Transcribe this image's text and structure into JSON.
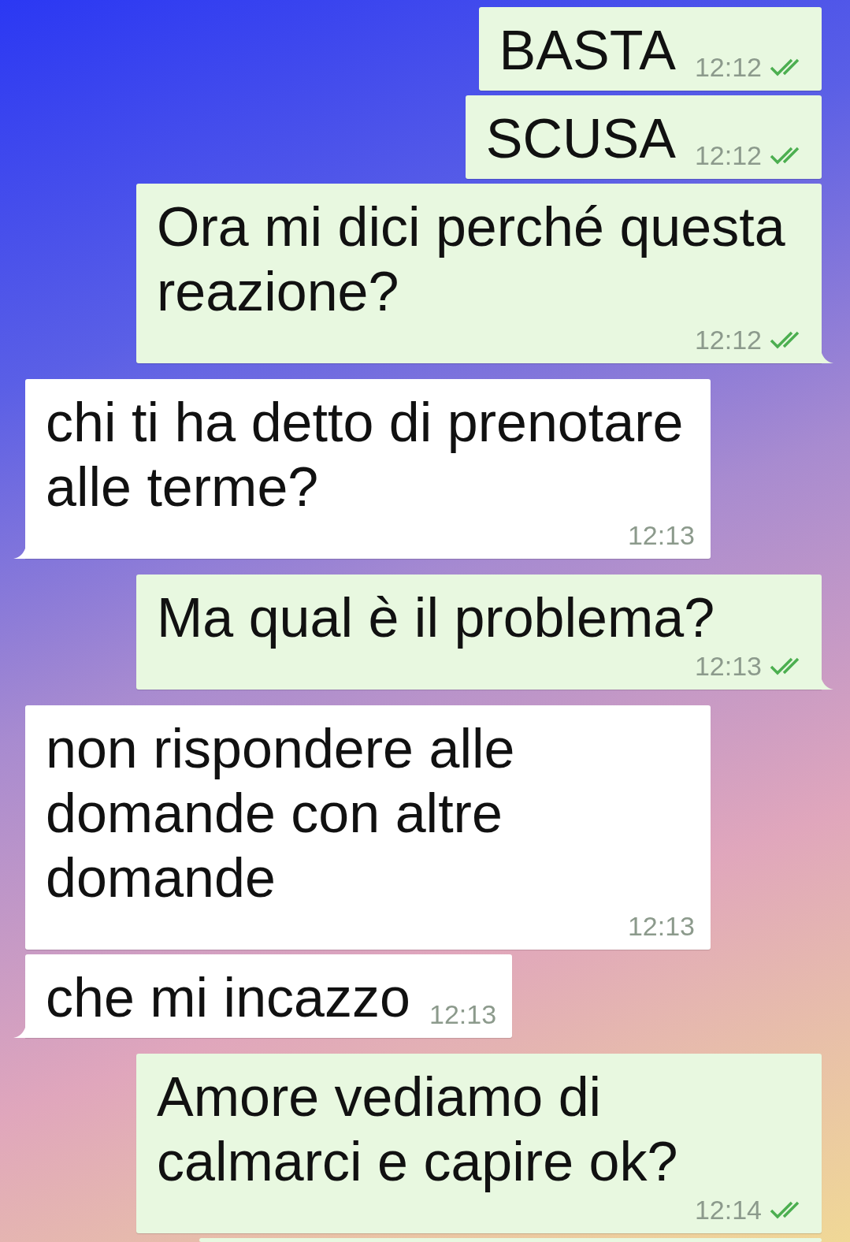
{
  "messages": [
    {
      "kind": "out",
      "text": "BASTA",
      "time": "12:12",
      "read": true,
      "tail": false
    },
    {
      "kind": "out",
      "text": "SCUSA",
      "time": "12:12",
      "read": true,
      "tail": false
    },
    {
      "kind": "out",
      "text": "Ora mi dici perché questa reazione?",
      "time": "12:12",
      "read": true,
      "tail": true
    },
    {
      "kind": "in",
      "text": "chi ti ha detto di prenotare alle terme?",
      "time": "12:13",
      "tail": true
    },
    {
      "kind": "out",
      "text": "Ma qual è il problema?",
      "time": "12:13",
      "read": true,
      "tail": true
    },
    {
      "kind": "in",
      "text": "non rispondere alle domande con altre domande",
      "time": "12:13",
      "tail": false
    },
    {
      "kind": "in",
      "text": "che mi incazzo",
      "time": "12:13",
      "tail": true
    },
    {
      "kind": "out",
      "text": "Amore vediamo di calmarci e capire ok?",
      "time": "12:14",
      "read": true,
      "tail": false
    }
  ]
}
